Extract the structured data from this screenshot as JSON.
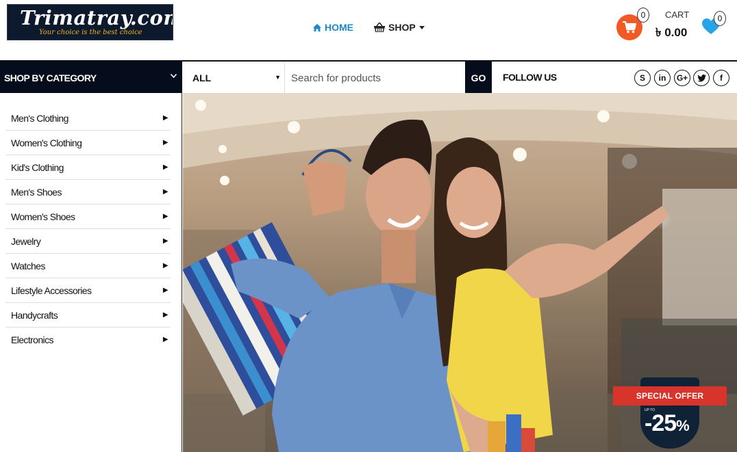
{
  "brand": {
    "name": "Trimatray.com",
    "tagline": "Your choice is the best choice"
  },
  "nav": {
    "home": {
      "label": "HOME",
      "icon": "home-icon"
    },
    "shop": {
      "label": "SHOP",
      "icon": "basket-icon"
    }
  },
  "cart": {
    "label": "CART",
    "total": "৳ 0.00",
    "count": "0",
    "icon": "cart-icon"
  },
  "wishlist": {
    "count": "0",
    "icon": "heart-icon"
  },
  "category_bar": {
    "title": "SHOP BY CATEGORY"
  },
  "search": {
    "category": "ALL",
    "placeholder": "Search for products",
    "go_label": "GO"
  },
  "follow": {
    "label": "FOLLOW US",
    "networks": [
      "skype-icon",
      "linkedin-icon",
      "google-plus-icon",
      "twitter-icon",
      "facebook-icon"
    ]
  },
  "categories": [
    {
      "label": "Men's Clothing"
    },
    {
      "label": "Women's Clothing"
    },
    {
      "label": "Kid's Clothing"
    },
    {
      "label": "Men's Shoes"
    },
    {
      "label": "Women's Shoes"
    },
    {
      "label": "Jewelry"
    },
    {
      "label": "Watches"
    },
    {
      "label": "Lifestyle Accessories"
    },
    {
      "label": "Handycrafts"
    },
    {
      "label": "Electronics"
    }
  ],
  "offer": {
    "title": "SPECIAL OFFER",
    "upto": "UP TO",
    "value": "-25",
    "unit": "%"
  },
  "colors": {
    "accent": "#1e88c8",
    "dark": "#050c1c",
    "cart": "#f15a24",
    "ribbon": "#d8342c"
  }
}
